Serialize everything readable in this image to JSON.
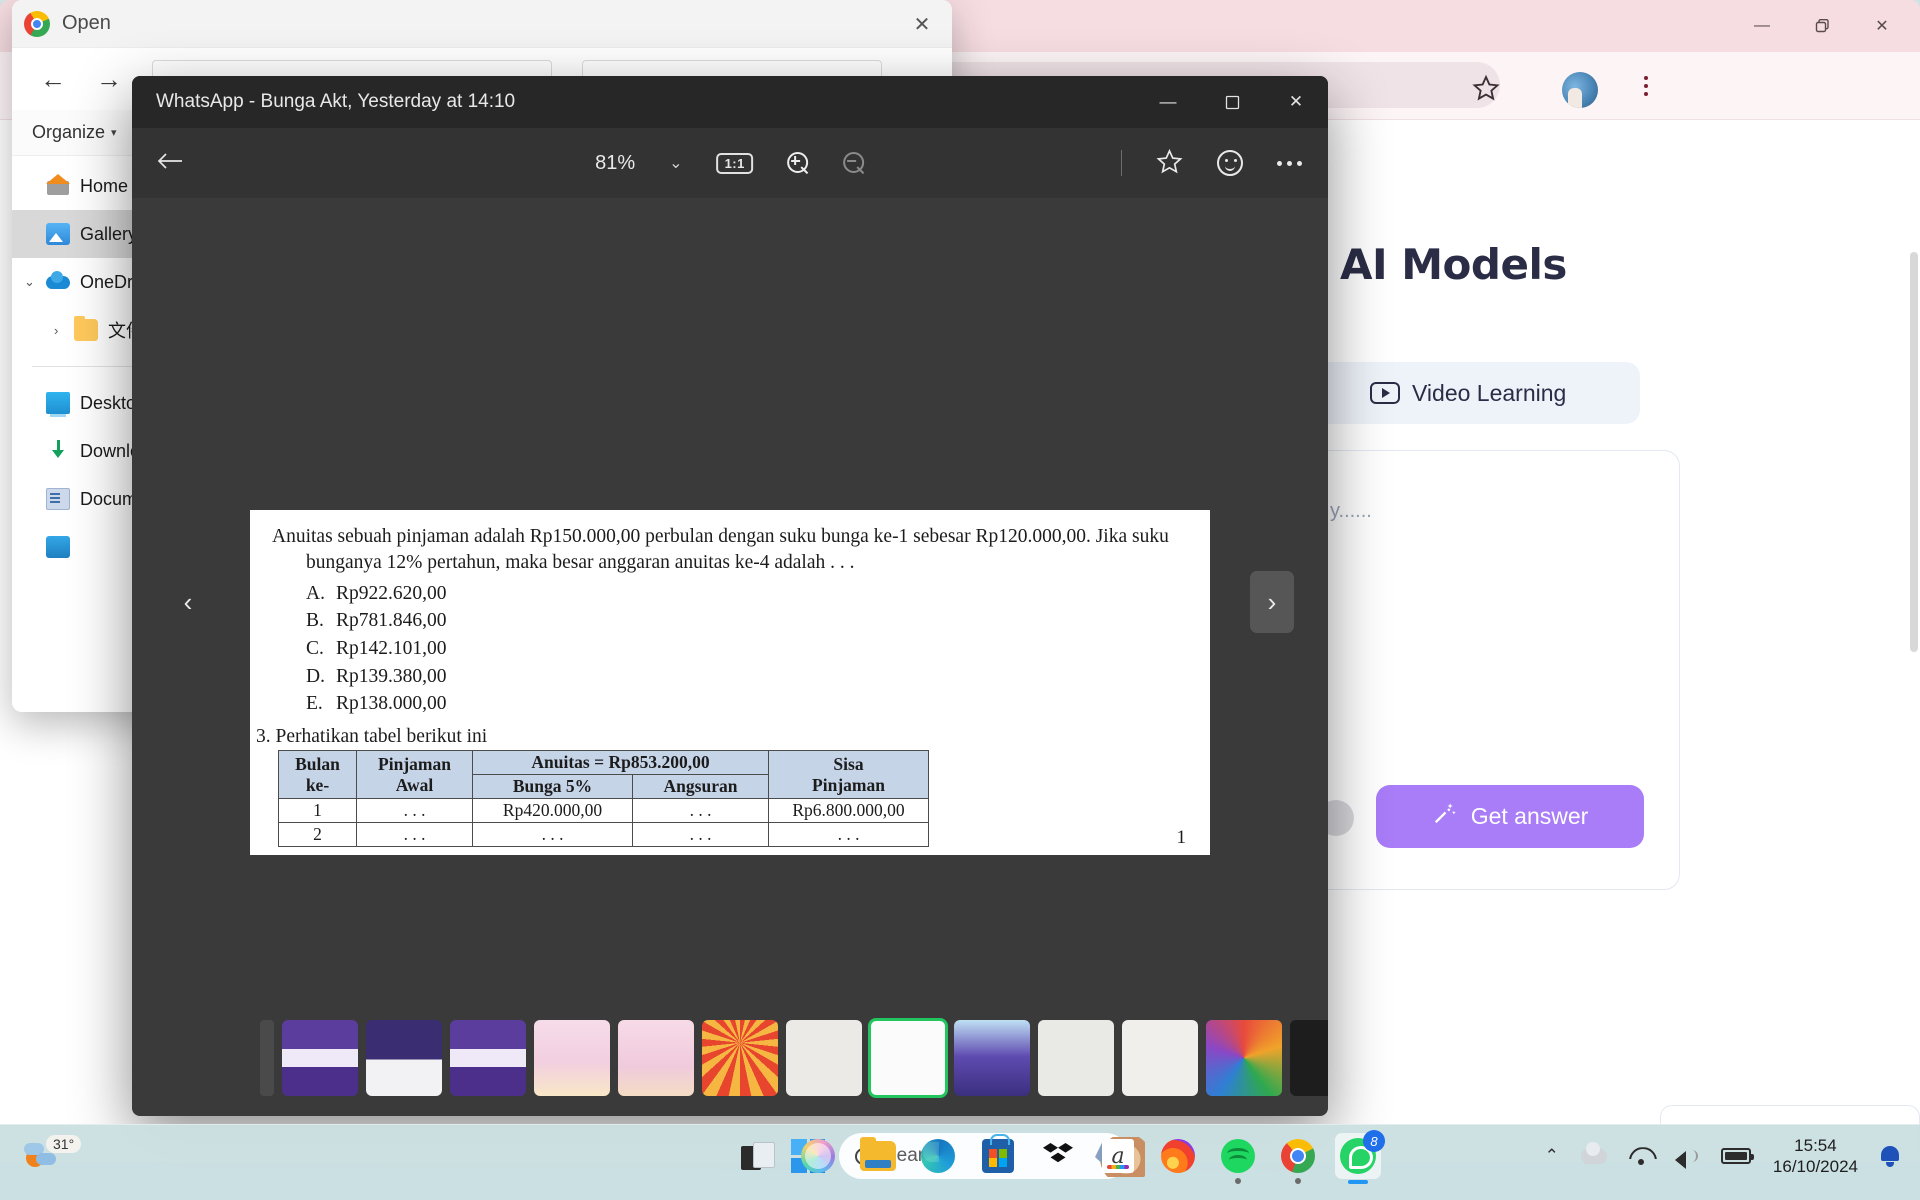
{
  "chrome_window": {
    "window_controls": {
      "minimize": "—",
      "restore": "❐",
      "close": "✕"
    },
    "toolbar": {
      "bookmark_icon": "star-icon",
      "profile_icon": "avatar",
      "menu_icon": "three-dot-menu-icon"
    },
    "page": {
      "title": "AI Models",
      "video_pill_label": "Video Learning",
      "card_placeholder": "y......",
      "get_answer_label": "Get answer",
      "accent_color": "#a97cf8"
    }
  },
  "open_dialog": {
    "title": "Open",
    "app_icon": "chrome-logo-icon",
    "close_label": "✕",
    "nav": {
      "back": "←",
      "forward": "→"
    },
    "command_bar": {
      "organize_label": "Organize",
      "caret": "▾"
    },
    "sidebar": {
      "items": [
        {
          "label": "Home",
          "icon": "home-icon",
          "selected": false,
          "expandable": false
        },
        {
          "label": "Gallery",
          "icon": "gallery-icon",
          "selected": true,
          "expandable": false
        },
        {
          "label": "OneDrive",
          "icon": "onedrive-icon",
          "selected": false,
          "expandable": true,
          "chevron": "⌄"
        },
        {
          "label": "文件",
          "icon": "folder-icon",
          "selected": false,
          "expandable": true,
          "chevron": "›"
        },
        {
          "label": "Desktop",
          "icon": "desktop-icon",
          "selected": false,
          "expandable": false
        },
        {
          "label": "Downloads",
          "icon": "downloads-icon",
          "selected": false,
          "expandable": false
        },
        {
          "label": "Documents",
          "icon": "documents-icon",
          "selected": false,
          "expandable": false
        }
      ]
    }
  },
  "photos_viewer": {
    "title": "WhatsApp - Bunga Akt, Yesterday at 14:10",
    "window_controls": {
      "minimize": "—",
      "maximize": "▢",
      "close": "✕"
    },
    "toolbar": {
      "back_icon": "back-arrow-icon",
      "zoom_level": "81%",
      "zoom_chevron": "⌄",
      "fit_label": "1:1",
      "zoom_in_icon": "zoom-in-icon",
      "zoom_out_icon": "zoom-out-icon",
      "favorite_icon": "star-icon",
      "reaction_icon": "smiley-icon",
      "more_icon": "more-options-icon"
    },
    "navigation": {
      "prev": "‹",
      "next": "›"
    },
    "document": {
      "question_2": {
        "line1": "Anuitas sebuah pinjaman adalah Rp150.000,00 perbulan dengan suku bunga ke-1 sebesar Rp120.000,00. Jika suku",
        "line2": "bunganya 12% pertahun, maka besar anggaran anuitas ke-4 adalah . . .",
        "options": [
          {
            "key": "A.",
            "value": "Rp922.620,00"
          },
          {
            "key": "B.",
            "value": "Rp781.846,00"
          },
          {
            "key": "C.",
            "value": "Rp142.101,00"
          },
          {
            "key": "D.",
            "value": "Rp139.380,00"
          },
          {
            "key": "E.",
            "value": "Rp138.000,00"
          }
        ]
      },
      "question_3": {
        "prompt": "3. Perhatikan tabel berikut ini",
        "table": {
          "group_header": "Anuitas = Rp853.200,00",
          "headers": [
            "Bulan ke-",
            "Pinjaman Awal",
            "Bunga 5%",
            "Angsuran",
            "Sisa Pinjaman"
          ],
          "header_parts": {
            "bulan_l1": "Bulan",
            "bulan_l2": "ke-",
            "pinjaman_l1": "Pinjaman",
            "pinjaman_l2": "Awal",
            "bunga": "Bunga 5%",
            "angsuran": "Angsuran",
            "sisa_l1": "Sisa",
            "sisa_l2": "Pinjaman"
          },
          "rows": [
            [
              "1",
              ". . .",
              "Rp420.000,00",
              ". . .",
              "Rp6.800.000,00"
            ],
            [
              "2",
              ". . .",
              ". . .",
              ". . .",
              ". . ."
            ]
          ]
        }
      },
      "page_number": "1"
    },
    "filmstrip": {
      "selected_index": 7,
      "thumbnails": [
        {
          "name": "kompetisi-debat-poster"
        },
        {
          "name": "fotografi-poster"
        },
        {
          "name": "kompetisi-debat-poster-2"
        },
        {
          "name": "pilan-prestasi-mahasiswa-poster"
        },
        {
          "name": "pilan-prestasi-mahasiswa-qr-poster"
        },
        {
          "name": "pom-poster"
        },
        {
          "name": "document-scan-1"
        },
        {
          "name": "anuitas-document"
        },
        {
          "name": "webinar-nasional-poster"
        },
        {
          "name": "document-scan-2"
        },
        {
          "name": "document-scan-3"
        },
        {
          "name": "spin-wheel-screenshot"
        },
        {
          "name": "dark-screenshot"
        }
      ]
    }
  },
  "taskbar": {
    "weather": {
      "temperature": "31°",
      "icon": "weather-partly-cloudy-icon"
    },
    "start_icon": "windows-start-icon",
    "search": {
      "placeholder": "Search",
      "icon": "search-icon"
    },
    "apps": [
      {
        "name": "task-view",
        "running": false
      },
      {
        "name": "copilot",
        "running": false
      },
      {
        "name": "file-explorer",
        "running": false
      },
      {
        "name": "microsoft-edge",
        "running": false
      },
      {
        "name": "microsoft-store",
        "running": false
      },
      {
        "name": "dropbox",
        "running": false
      },
      {
        "name": "amazon",
        "running": false
      },
      {
        "name": "firefox",
        "running": false
      },
      {
        "name": "spotify",
        "running": true
      },
      {
        "name": "google-chrome",
        "running": true
      },
      {
        "name": "whatsapp",
        "running": true,
        "active": true,
        "badge": "8"
      }
    ],
    "tray": {
      "overflow_icon": "chevron-up-icon",
      "onedrive_icon": "cloud-icon",
      "wifi_icon": "wifi-icon",
      "volume_icon": "volume-icon",
      "battery_icon": "battery-icon",
      "time": "15:54",
      "date": "16/10/2024",
      "notification_icon": "bell-icon"
    }
  }
}
